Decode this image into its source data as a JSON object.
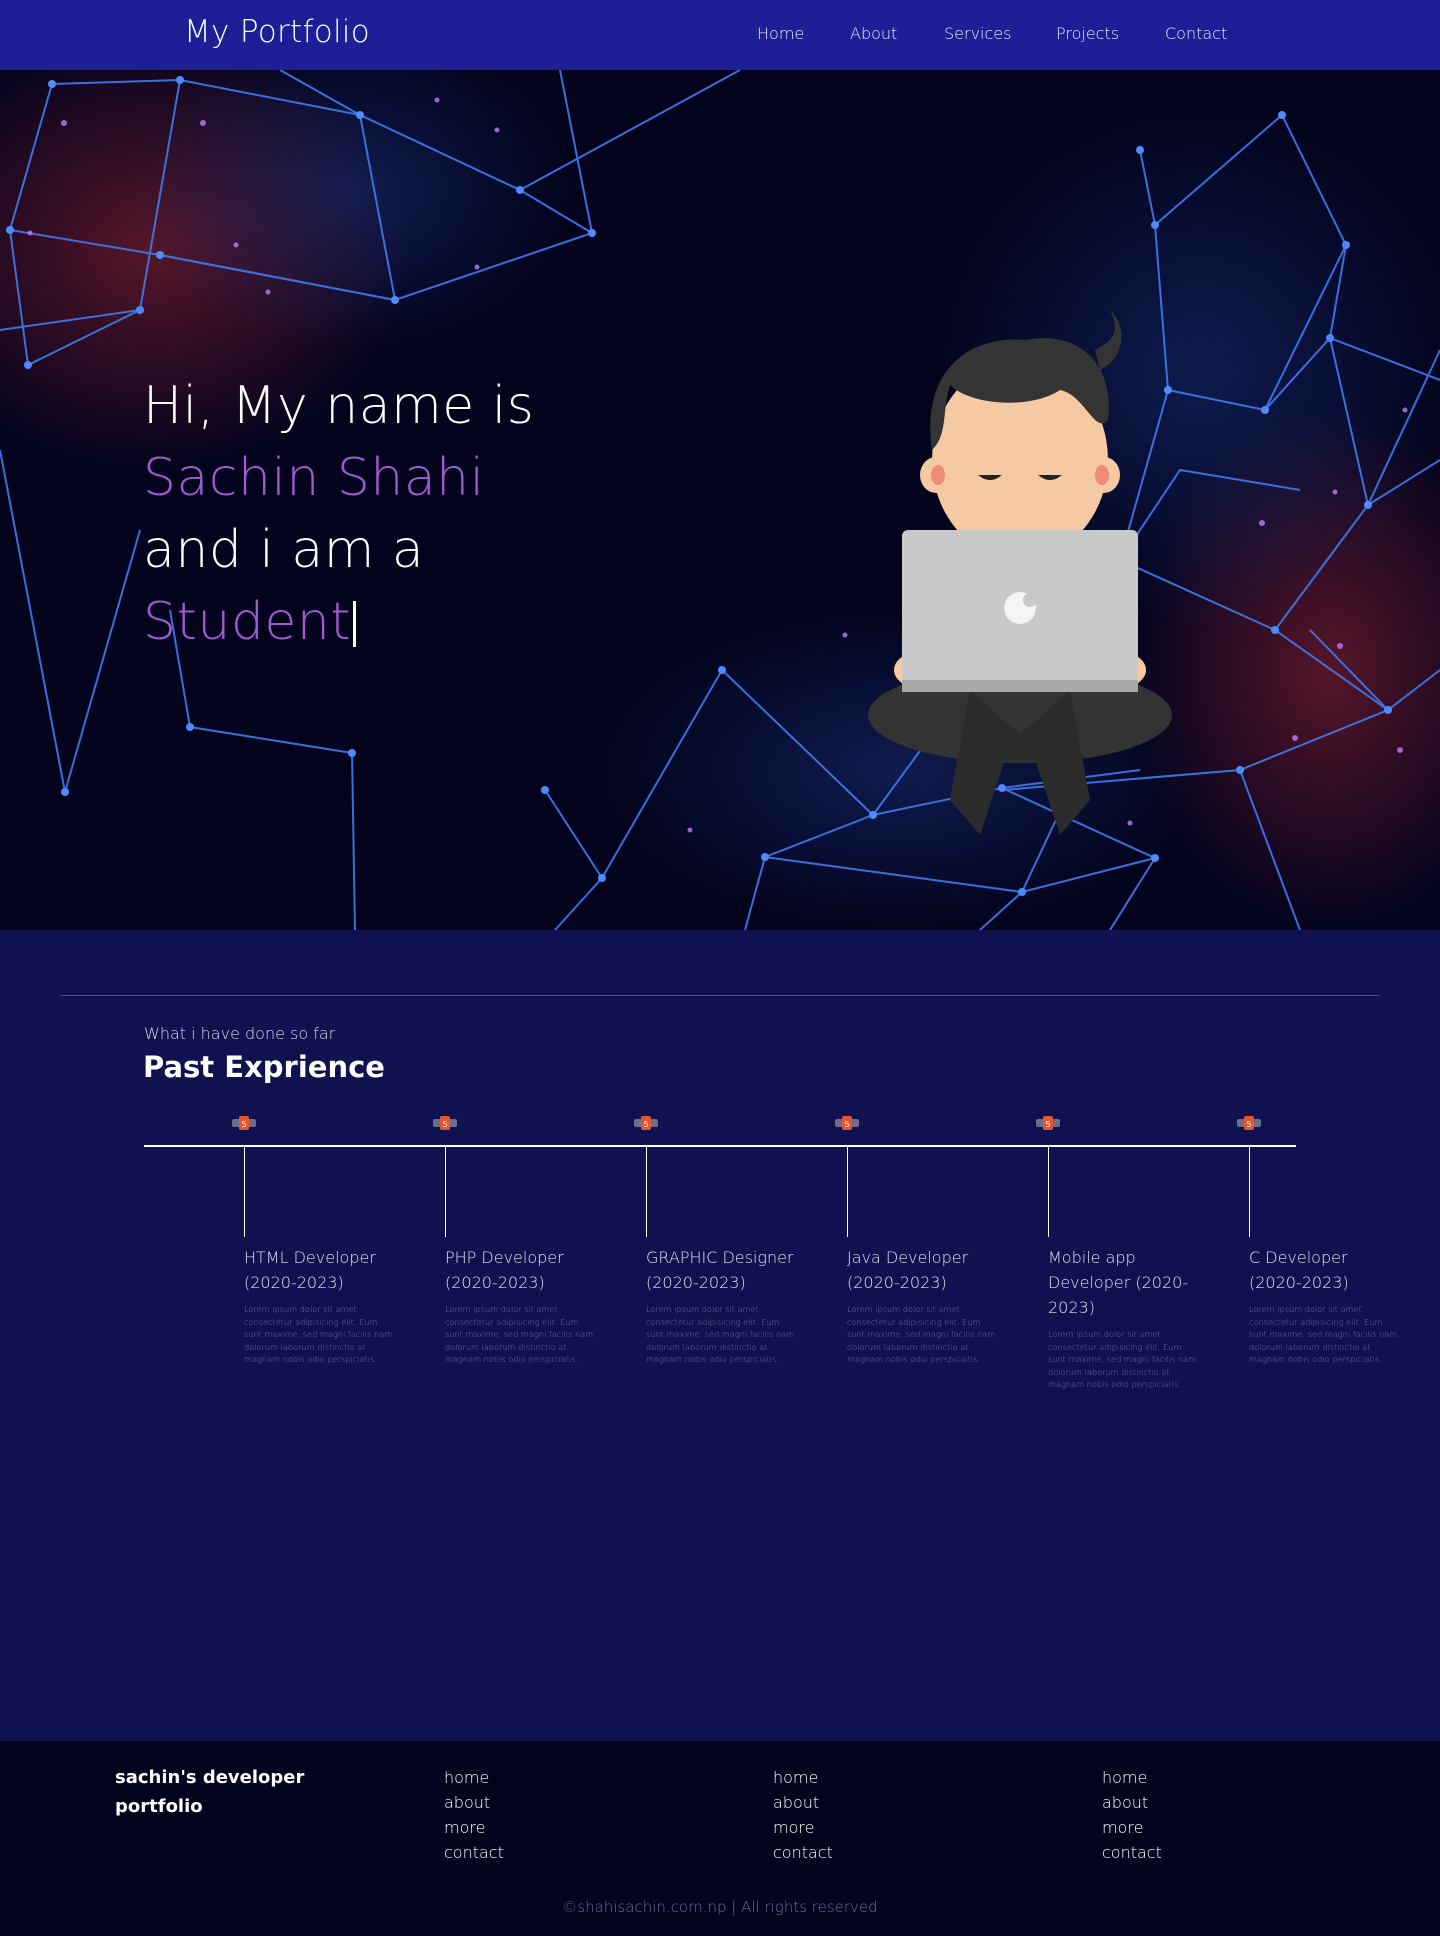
{
  "nav": {
    "brand": "My Portfolio",
    "links": [
      "Home",
      "About",
      "Services",
      "Projects",
      "Contact"
    ]
  },
  "hero": {
    "line1": "Hi, My name is",
    "name": "Sachin Shahi",
    "line3": "and i am a",
    "role": "Student"
  },
  "experience": {
    "kicker": "What i have done so far",
    "title": "Past Exprience",
    "items": [
      {
        "role": "HTML Developer (2020-2023)",
        "desc": "Lorem ipsum dolor sit amet consectetur adipisicing elit. Eum sunt maxime, sed magni facilis nam dolorum laborum distinctio at magnam nobis odio perspiciatis."
      },
      {
        "role": "PHP Developer (2020-2023)",
        "desc": "Lorem ipsum dolor sit amet consectetur adipisicing elit. Eum sunt maxime, sed magni facilis nam dolorum laborum distinctio at magnam nobis odio perspiciatis."
      },
      {
        "role": "GRAPHIC Designer (2020-2023)",
        "desc": "Lorem ipsum dolor sit amet consectetur adipisicing elit. Eum sunt maxime, sed magni facilis nam dolorum laborum distinctio at magnam nobis odio perspiciatis."
      },
      {
        "role": "Java Developer (2020-2023)",
        "desc": "Lorem ipsum dolor sit amet consectetur adipisicing elit. Eum sunt maxime, sed magni facilis nam dolorum laborum distinctio at magnam nobis odio perspiciatis."
      },
      {
        "role": "Mobile app Developer (2020-2023)",
        "desc": "Lorem ipsum dolor sit amet consectetur adipisicing elit. Eum sunt maxime, sed magni facilis nam dolorum laborum distinctio at magnam nobis odio perspiciatis."
      },
      {
        "role": "C Developer (2020-2023)",
        "desc": "Lorem ipsum dolor sit amet consectetur adipisicing elit. Eum sunt maxime, sed magni facilis nam dolorum laborum distinctio at magnam nobis odio perspiciatis."
      }
    ]
  },
  "footer": {
    "brand": "sachin's developer portfolio",
    "columns": [
      [
        "home",
        "about",
        "more",
        "contact"
      ],
      [
        "home",
        "about",
        "more",
        "contact"
      ],
      [
        "home",
        "about",
        "more",
        "contact"
      ]
    ],
    "copyright": "©shahisachin.com.np | All rights reserved"
  },
  "colors": {
    "nav": "#1c1f96",
    "body": "#10124f",
    "hero": "#03031d",
    "accent": "#a25ad0",
    "network": "#3f7bf0"
  }
}
